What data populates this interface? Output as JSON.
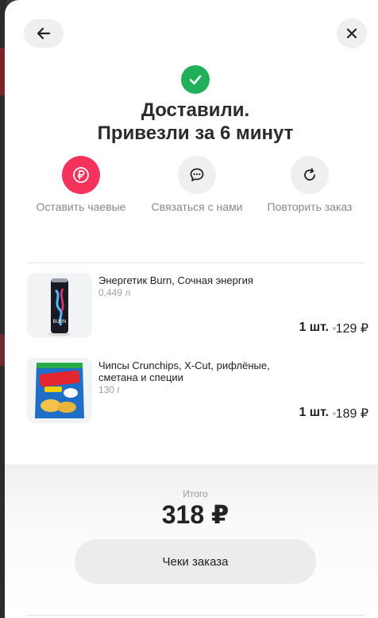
{
  "status": {
    "title_line1": "Доставили.",
    "title_line2": "Привезли за 6 минут"
  },
  "actions": [
    {
      "label": "Оставить чаевые",
      "icon": "ruble-icon"
    },
    {
      "label": "Связаться с нами",
      "icon": "chat-bubble-icon"
    },
    {
      "label": "Повторить заказ",
      "icon": "repeat-icon"
    }
  ],
  "order_items": [
    {
      "name": "Энергетик Burn, Сочная энергия",
      "weight": "0,449 л",
      "quantity": "1 шт.",
      "price": "129 ₽"
    },
    {
      "name": "Чипсы Crunchips, X-Cut, рифлёные, сметана и специи",
      "weight": "130 г",
      "quantity": "1 шт.",
      "price": "189 ₽"
    }
  ],
  "summary": {
    "total_label": "Итого",
    "total_value": "318 ₽",
    "receipts_button": "Чеки заказа"
  },
  "colors": {
    "success": "#20b05a",
    "tip_accent": "#f5325c"
  }
}
